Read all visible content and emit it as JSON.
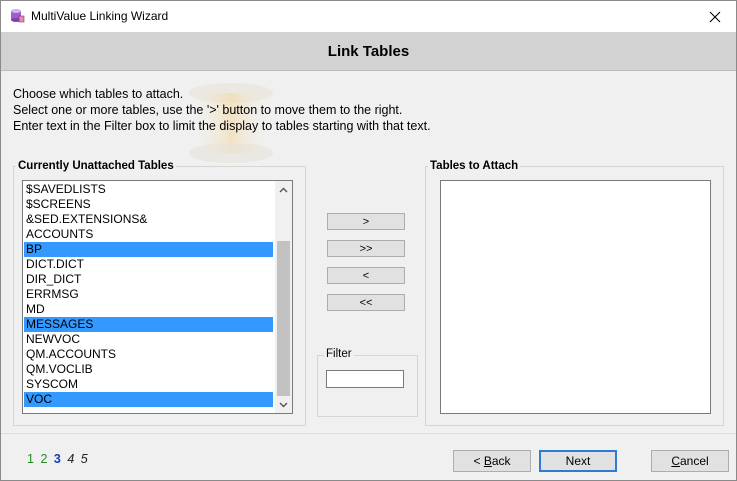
{
  "window": {
    "title": "MultiValue Linking Wizard",
    "close_symbol": "✕"
  },
  "header": {
    "title": "Link Tables"
  },
  "instructions": [
    "Choose which tables to attach.",
    "Select one or more tables, use the '>' button to move them to the right.",
    "Enter text in the Filter box to limit the display to tables starting with that text."
  ],
  "unattached": {
    "label": "Currently Unattached Tables",
    "items": [
      {
        "label": "$SAVEDLISTS",
        "selected": false
      },
      {
        "label": "$SCREENS",
        "selected": false
      },
      {
        "label": "&SED.EXTENSIONS&",
        "selected": false
      },
      {
        "label": "ACCOUNTS",
        "selected": false
      },
      {
        "label": "BP",
        "selected": true
      },
      {
        "label": "DICT.DICT",
        "selected": false
      },
      {
        "label": "DIR_DICT",
        "selected": false
      },
      {
        "label": "ERRMSG",
        "selected": false
      },
      {
        "label": "MD",
        "selected": false
      },
      {
        "label": "MESSAGES",
        "selected": true
      },
      {
        "label": "NEWVOC",
        "selected": false
      },
      {
        "label": "QM.ACCOUNTS",
        "selected": false
      },
      {
        "label": "QM.VOCLIB",
        "selected": false
      },
      {
        "label": "SYSCOM",
        "selected": false
      },
      {
        "label": "VOC",
        "selected": true
      }
    ]
  },
  "move_buttons": {
    "move_right": ">",
    "move_all_right": ">>",
    "move_left": "<",
    "move_all_left": "<<"
  },
  "filter": {
    "label": "Filter",
    "value": ""
  },
  "attach": {
    "label": "Tables to Attach",
    "items": []
  },
  "steps": {
    "done": [
      "1",
      "2"
    ],
    "current": "3",
    "future": [
      "4",
      "5"
    ]
  },
  "footer": {
    "back_mnemonic": "B",
    "back_rest": "ack",
    "back_prefix": "< ",
    "next_label": "Next",
    "cancel_mnemonic": "C",
    "cancel_rest": "ancel"
  }
}
